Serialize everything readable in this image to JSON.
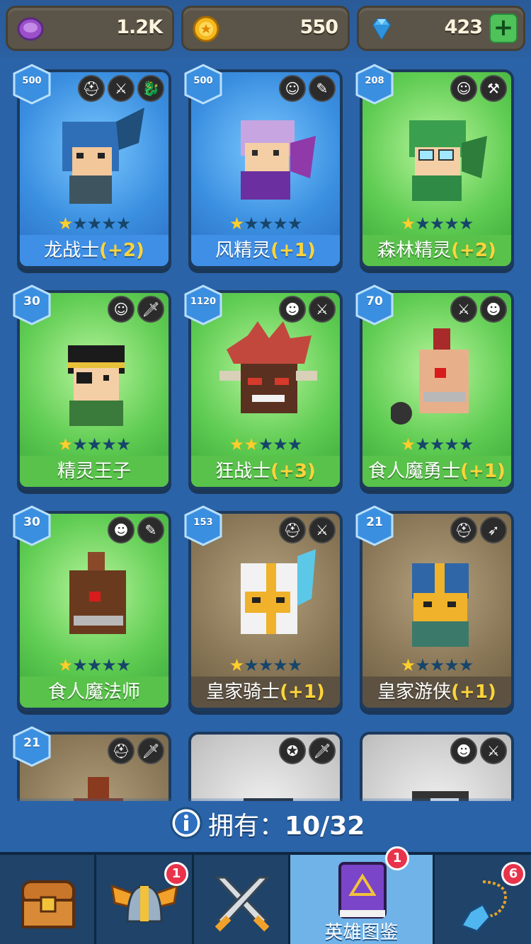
{
  "resources": {
    "purple": {
      "icon": "purple-gem-icon",
      "value": "1.2K"
    },
    "gold": {
      "icon": "gold-coin-icon",
      "value": "550"
    },
    "diamond": {
      "icon": "diamond-icon",
      "value": "423",
      "plus": "+"
    }
  },
  "heroes": [
    {
      "level": "500",
      "name": "龙战士",
      "bonus": "(+2)",
      "stars": 1,
      "theme": "blue",
      "icons": [
        "helmet-icon",
        "sword-icon",
        "dragon-icon"
      ]
    },
    {
      "level": "500",
      "name": "风精灵",
      "bonus": "(+1)",
      "stars": 1,
      "theme": "blue",
      "icons": [
        "elf-icon",
        "staff-icon"
      ]
    },
    {
      "level": "208",
      "name": "森林精灵",
      "bonus": "(+2)",
      "stars": 1,
      "theme": "green",
      "icons": [
        "elf-icon",
        "hammer-icon"
      ]
    },
    {
      "level": "30",
      "name": "精灵王子",
      "bonus": "",
      "stars": 1,
      "theme": "green",
      "icons": [
        "elf-icon",
        "dagger-icon"
      ]
    },
    {
      "level": "1120",
      "name": "狂战士",
      "bonus": "(+3)",
      "stars": 2,
      "theme": "green",
      "icons": [
        "orc-icon",
        "sword-icon"
      ]
    },
    {
      "level": "70",
      "name": "食人魔勇士",
      "bonus": "(+1)",
      "stars": 1,
      "theme": "green",
      "icons": [
        "sword-icon",
        "orc-icon"
      ]
    },
    {
      "level": "30",
      "name": "食人魔法师",
      "bonus": "",
      "stars": 1,
      "theme": "green",
      "icons": [
        "orc-icon",
        "staff-icon"
      ]
    },
    {
      "level": "153",
      "name": "皇家骑士",
      "bonus": "(+1)",
      "stars": 1,
      "theme": "brown",
      "icons": [
        "helmet-icon",
        "sword-icon"
      ]
    },
    {
      "level": "21",
      "name": "皇家游侠",
      "bonus": "(+1)",
      "stars": 1,
      "theme": "brown",
      "icons": [
        "helmet-icon",
        "bow-icon"
      ]
    },
    {
      "level": "21",
      "name": "",
      "bonus": "",
      "stars": 0,
      "theme": "brown",
      "icons": [
        "helmet-icon",
        "dagger-icon"
      ]
    },
    {
      "level": "",
      "name": "",
      "bonus": "",
      "stars": 0,
      "theme": "grey",
      "icons": [
        "angel-icon",
        "dagger-icon"
      ]
    },
    {
      "level": "",
      "name": "",
      "bonus": "",
      "stars": 0,
      "theme": "grey",
      "icons": [
        "orc-icon",
        "sword-icon"
      ]
    }
  ],
  "owned": {
    "label": "拥有：",
    "count": "10/32"
  },
  "nav": [
    {
      "icon": "treasure-chest-icon",
      "label": "",
      "badge": ""
    },
    {
      "icon": "winged-helmet-icon",
      "label": "",
      "badge": "1"
    },
    {
      "icon": "crossed-swords-icon",
      "label": "",
      "badge": ""
    },
    {
      "icon": "hero-book-icon",
      "label": "英雄图鉴",
      "badge": "1",
      "active": true
    },
    {
      "icon": "amulet-icon",
      "label": "",
      "badge": "6"
    }
  ],
  "colors": {
    "accent_gold": "#ffd43a",
    "badge_red": "#e8334b",
    "background": "#2a63a8"
  }
}
